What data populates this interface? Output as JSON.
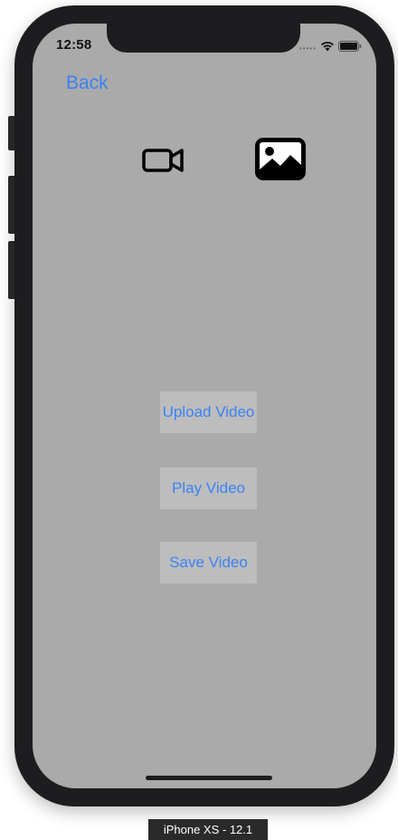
{
  "status_bar": {
    "time": "12:58",
    "signal_icon": "signal-dots-icon",
    "wifi_icon": "wifi-icon",
    "battery_icon": "battery-icon"
  },
  "nav": {
    "back_label": "Back"
  },
  "toolbar": {
    "camera_icon": "video-camera-icon",
    "gallery_icon": "photo-library-icon"
  },
  "actions": {
    "upload_label": "Upload Video",
    "play_label": "Play Video",
    "save_label": "Save Video"
  },
  "simulator": {
    "device_label": "iPhone XS - 12.1"
  },
  "colors": {
    "screen_background": "#aaaaaa",
    "button_background": "#bdbdbd",
    "link_blue": "#3a82f7",
    "device_frame": "#1d1d1f"
  }
}
